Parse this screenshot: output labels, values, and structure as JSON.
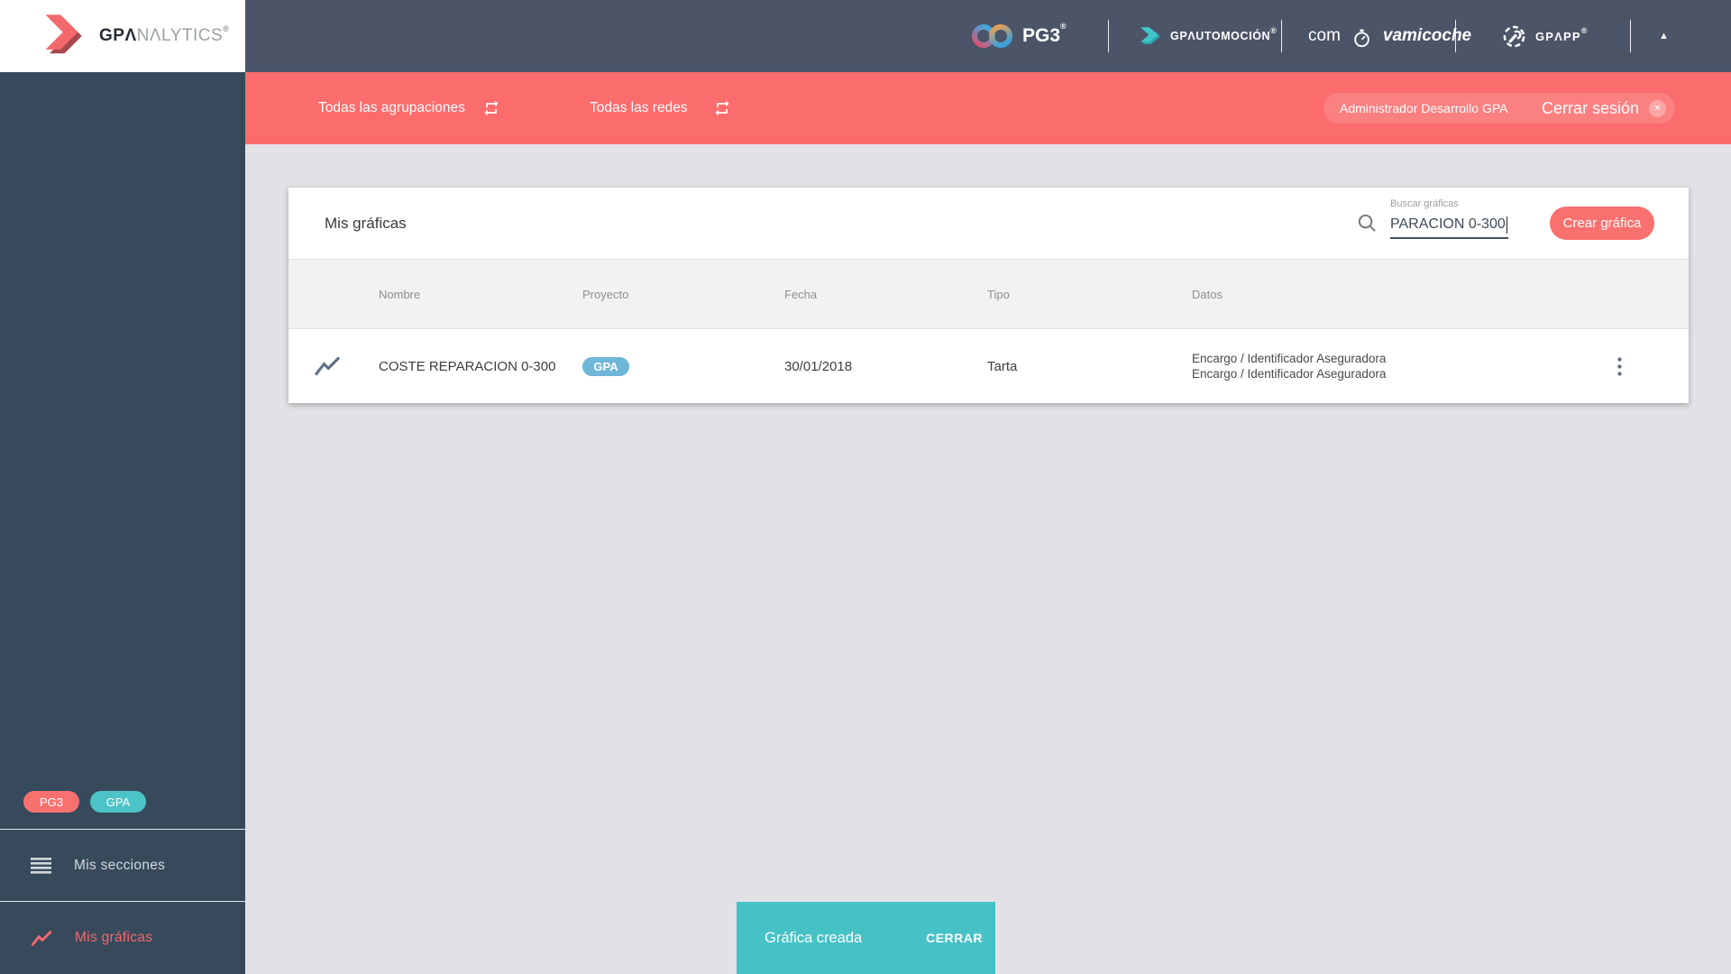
{
  "colors": {
    "topbar": "#4c5568",
    "sidebar": "#374a5c",
    "accent_red": "#fb6c6c",
    "button_red": "#f8716f",
    "snackbar_teal": "#46c1c6",
    "badge_teal": "#4cc3c7",
    "badge_blue": "#6fb6d8",
    "background": "#e2e2e6"
  },
  "brand": {
    "bold": "GPΛ",
    "light": "NΛLYTICS",
    "reg": "®"
  },
  "topbar": {
    "pg3": {
      "label": "PG3",
      "reg": "®"
    },
    "gpautomocion": {
      "label": "GPΛUTOMOCIÓN",
      "reg": "®"
    },
    "comprovamicoche": {
      "pre": "com",
      "post": "vamicoche"
    },
    "gpapp": {
      "label": "GPΛPP",
      "reg": "®"
    }
  },
  "icons": {
    "logout_x": "✕",
    "collapse_arrow": "▲"
  },
  "filterbar": {
    "agrupaciones": "Todas las agrupaciones",
    "redes": "Todas las redes",
    "user_name": "Administrador Desarrollo GPA",
    "logout": "Cerrar sesión"
  },
  "sidebar": {
    "badges": [
      {
        "label": "PG3"
      },
      {
        "label": "GPA"
      }
    ],
    "items": [
      {
        "label": "Mis secciones"
      },
      {
        "label": "Mis gráficas"
      }
    ]
  },
  "main": {
    "card_title": "Mis gráficas",
    "search": {
      "label": "Buscar gráficas",
      "value": "PARACION 0-300"
    },
    "create_button": "Crear gráfica",
    "table": {
      "headers": [
        "Nombre",
        "Proyecto",
        "Fecha",
        "Tipo",
        "Datos"
      ],
      "rows": [
        {
          "nombre": "COSTE REPARACION 0-300",
          "proyecto": "GPA",
          "fecha": "30/01/2018",
          "tipo": "Tarta",
          "datos": [
            "Encargo / Identificador Aseguradora",
            "Encargo / Identificador Aseguradora"
          ]
        }
      ]
    }
  },
  "snackbar": {
    "message": "Gráfica creada",
    "action": "CERRAR"
  }
}
